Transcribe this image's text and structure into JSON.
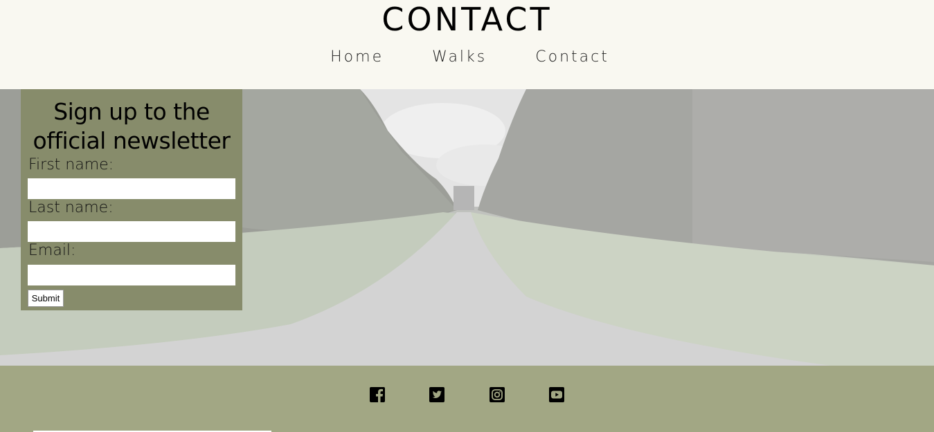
{
  "header": {
    "title": "CONTACT",
    "nav": [
      "Home",
      "Walks",
      "Contact"
    ]
  },
  "signup": {
    "heading": "Sign up to the official newsletter",
    "fields": [
      {
        "label": "First name:",
        "value": ""
      },
      {
        "label": "Last name:",
        "value": ""
      },
      {
        "label": "Email:",
        "value": ""
      }
    ],
    "submit_label": "Submit"
  },
  "footer": {
    "social_icons": [
      "facebook-icon",
      "twitter-icon",
      "instagram-icon",
      "youtube-icon"
    ]
  },
  "colors": {
    "header_bg": "#f9f8f1",
    "panel_bg": "#878c6b",
    "footer_bg": "#a2a784"
  }
}
